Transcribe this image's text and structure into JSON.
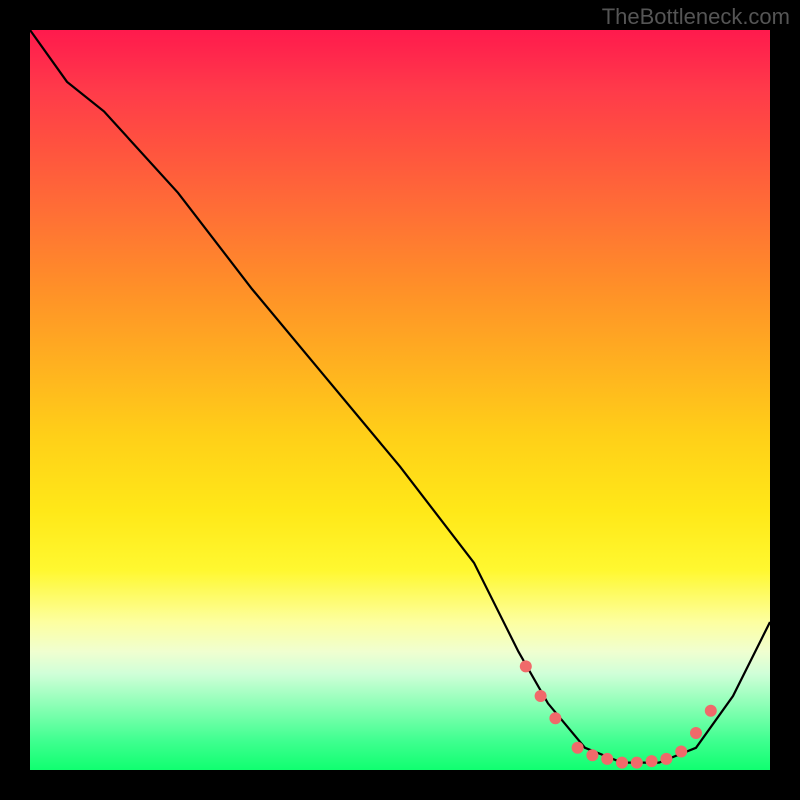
{
  "watermark": "TheBottleneck.com",
  "chart_data": {
    "type": "line",
    "title": "",
    "xlabel": "",
    "ylabel": "",
    "xlim": [
      0,
      100
    ],
    "ylim": [
      0,
      100
    ],
    "series": [
      {
        "name": "curve",
        "x": [
          0,
          5,
          10,
          20,
          30,
          40,
          50,
          60,
          66,
          70,
          75,
          80,
          85,
          90,
          95,
          100
        ],
        "values": [
          100,
          93,
          89,
          78,
          65,
          53,
          41,
          28,
          16,
          9,
          3,
          1,
          1,
          3,
          10,
          20
        ]
      }
    ],
    "markers": {
      "name": "dots",
      "x": [
        67,
        69,
        71,
        74,
        76,
        78,
        80,
        82,
        84,
        86,
        88,
        90,
        92
      ],
      "values": [
        14,
        10,
        7,
        3,
        2,
        1.5,
        1,
        1,
        1.2,
        1.5,
        2.5,
        5,
        8
      ]
    },
    "colors": {
      "curve": "#000000",
      "dots": "#f06a6a",
      "gradient_top": "#ff1a4d",
      "gradient_mid": "#ffe818",
      "gradient_bottom": "#10ff70"
    }
  }
}
